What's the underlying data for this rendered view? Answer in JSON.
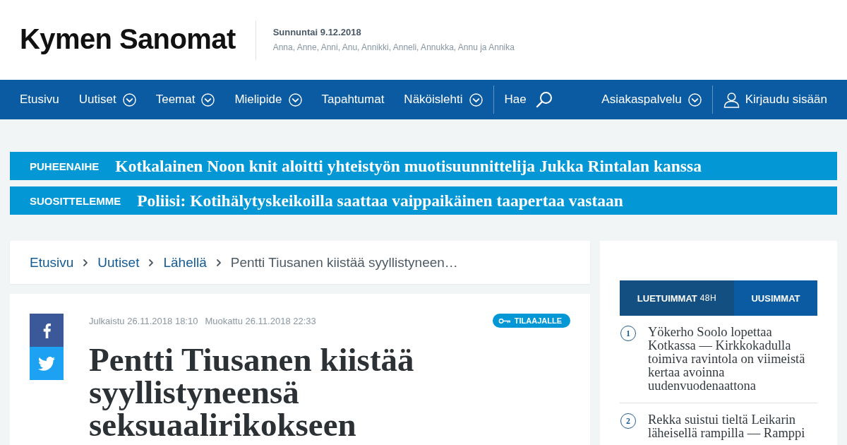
{
  "header": {
    "logo": "Kymen Sanomat",
    "date": "Sunnuntai 9.12.2018",
    "name_days": "Anna, Anne, Anni, Anu, Annikki, Anneli, Annukka, Annu ja Annika"
  },
  "nav": {
    "items": [
      {
        "label": "Etusivu",
        "kind": "link",
        "dropdown": false
      },
      {
        "label": "Uutiset",
        "kind": "link",
        "dropdown": true
      },
      {
        "label": "Teemat",
        "kind": "link",
        "dropdown": true
      },
      {
        "label": "Mielipide",
        "kind": "link",
        "dropdown": true
      },
      {
        "label": "Tapahtumat",
        "kind": "link",
        "dropdown": false
      },
      {
        "label": "Näköislehti",
        "kind": "link",
        "dropdown": true
      },
      {
        "label": "Hae",
        "kind": "search",
        "dropdown": false
      },
      {
        "label": "Asiakaspalvelu",
        "kind": "link",
        "dropdown": true
      },
      {
        "label": "Kirjaudu sisään",
        "kind": "login",
        "dropdown": false
      }
    ]
  },
  "banners": [
    {
      "label": "PUHEENAIHE",
      "headline": "Kotkalainen Noon knit aloitti yhteistyön muotisuunnittelija Jukka Rintalan kanssa"
    },
    {
      "label": "SUOSITTELEMME",
      "headline": "Poliisi: Kotihälytyskeikoilla saattaa vaippaikäinen taapertaa vastaan"
    }
  ],
  "breadcrumb": {
    "items": [
      {
        "label": "Etusivu",
        "kind": "link"
      },
      {
        "label": "Uutiset",
        "kind": "link"
      },
      {
        "label": "Lähellä",
        "kind": "link"
      },
      {
        "label": "Pentti Tiusanen kiistää syyllistyneen…",
        "kind": "current"
      }
    ]
  },
  "article": {
    "share": [
      {
        "kind": "facebook"
      },
      {
        "kind": "twitter"
      }
    ],
    "published": "Julkaistu 26.11.2018 18:10",
    "modified": "Muokattu 26.11.2018 22:33",
    "tag": "TILAAJALLE",
    "title": "Pentti Tiusanen kiistää syyllistyneensä seksuaalirikokseen"
  },
  "most_read": {
    "tabs": [
      {
        "label": "LUETUIMMAT",
        "suffix": "48H",
        "selected": true
      },
      {
        "label": "UUSIMMAT",
        "selected": false
      }
    ],
    "items": [
      {
        "rank": "1",
        "title": "Yökerho Soolo lopettaa Kotkassa — Kirkkokadulla toimiva ravintola on viimeistä kertaa avoinna uudenvuodenaattona"
      },
      {
        "rank": "2",
        "title": "Rekka suistui tieltä Leikarin läheisellä rampilla — Ramppi"
      }
    ]
  }
}
